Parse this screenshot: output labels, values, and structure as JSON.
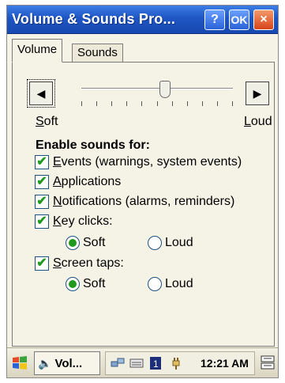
{
  "window": {
    "title": "Volume & Sounds Pro...",
    "help_label": "?",
    "ok_label": "OK",
    "close_label": "×"
  },
  "tabs": [
    {
      "label": "Volume",
      "active": true
    },
    {
      "label": "Sounds",
      "active": false
    }
  ],
  "volume": {
    "soft_label": "Soft",
    "loud_label": "Loud",
    "level_fraction": 0.55
  },
  "enable_heading": "Enable sounds for:",
  "checkboxes": [
    {
      "label": "Events (warnings, system events)",
      "checked": true
    },
    {
      "label": "Applications",
      "checked": true
    },
    {
      "label": "Notifications (alarms, reminders)",
      "checked": true
    },
    {
      "label": "Key clicks:",
      "checked": true
    },
    {
      "label": "Screen taps:",
      "checked": true
    }
  ],
  "key_clicks": {
    "soft_label": "Soft",
    "loud_label": "Loud",
    "selected": "Soft"
  },
  "screen_taps": {
    "soft_label": "Soft",
    "loud_label": "Loud",
    "selected": "Soft"
  },
  "taskbar": {
    "task_label": "Vol...",
    "clock": "12:21 AM"
  },
  "colors": {
    "titlebar": "#1e56c4",
    "check": "#1f9a1f",
    "close": "#d7441a"
  }
}
